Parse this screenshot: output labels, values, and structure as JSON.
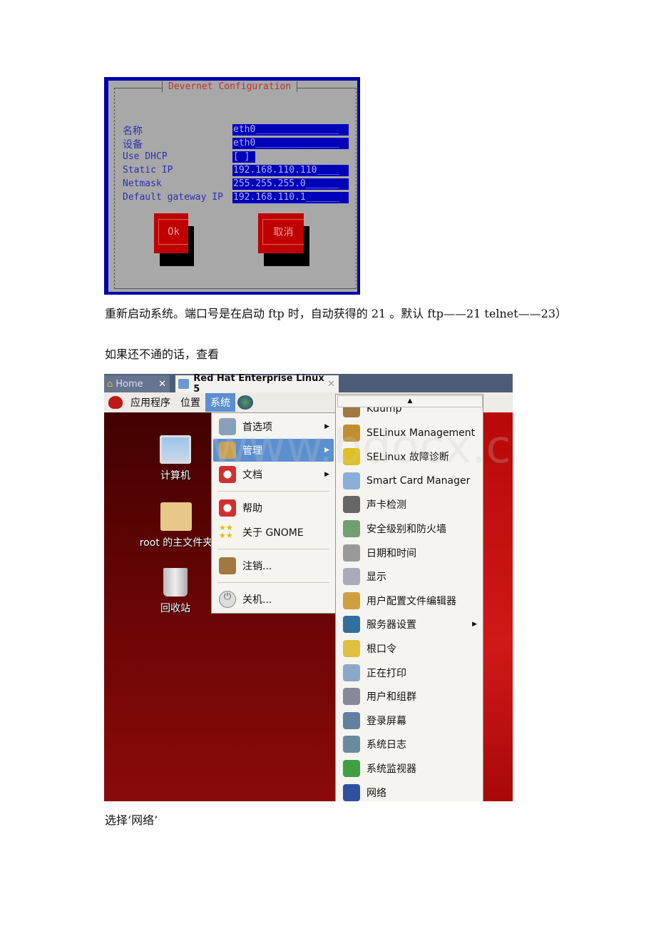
{
  "doc": {
    "para1": "重新启动系统。端口号是在启动 ftp 时，自动获得的 21 。默认 ftp——21 telnet——23）",
    "para2": "如果还不通的话，查看",
    "para3": "选择‘网络’"
  },
  "netconfig": {
    "title": "Devernet Configuration",
    "fields": [
      {
        "label": "名称",
        "value": "eth0_______________"
      },
      {
        "label": "设备",
        "value": "eth0_______________"
      },
      {
        "label": "Use DHCP",
        "value": "[ ]"
      },
      {
        "label": "Static IP",
        "value": "192.168.110.110____"
      },
      {
        "label": "Netmask",
        "value": "255.255.255.0______"
      },
      {
        "label": "Default gateway IP",
        "value": "192.168.110.1______"
      }
    ],
    "ok_label": "Ok",
    "cancel_label": "取消"
  },
  "gnome": {
    "tabs": [
      {
        "label": "Home"
      },
      {
        "label": "Red Hat Enterprise Linux 5"
      }
    ],
    "panel": [
      "应用程序",
      "位置",
      "系统"
    ],
    "desktop": [
      "计算机",
      "root 的主文件夹",
      "回收站"
    ],
    "system_menu": [
      {
        "label": "首选项",
        "submenu": true,
        "icon": "preferences-icon"
      },
      {
        "label": "管理",
        "submenu": true,
        "highlighted": true,
        "icon": "administration-icon"
      },
      {
        "label": "文档",
        "submenu": true,
        "icon": "help-ring-icon"
      },
      {
        "label": "帮助",
        "icon": "help-ring-icon"
      },
      {
        "label": "关于 GNOME",
        "icon": "stars-icon"
      },
      {
        "label": "注销...",
        "icon": "logout-icon"
      },
      {
        "label": "关机...",
        "icon": "power-icon"
      }
    ],
    "admin_menu": [
      "Kdump",
      "SELinux Management",
      "SELinux 故障诊断",
      "Smart Card Manager",
      "声卡检测",
      "安全级别和防火墙",
      "日期和时间",
      "显示",
      "用户配置文件编辑器",
      "服务器设置",
      "根口令",
      "正在打印",
      "用户和组群",
      "登录屏幕",
      "系统日志",
      "系统监视器",
      "网络"
    ],
    "admin_submenu_index": 9,
    "watermark": "www.bdocx.com",
    "colors": {
      "highlight": "#5b8fd0",
      "desktop": "#6a0505",
      "tabbar": "#4d5d77"
    }
  }
}
